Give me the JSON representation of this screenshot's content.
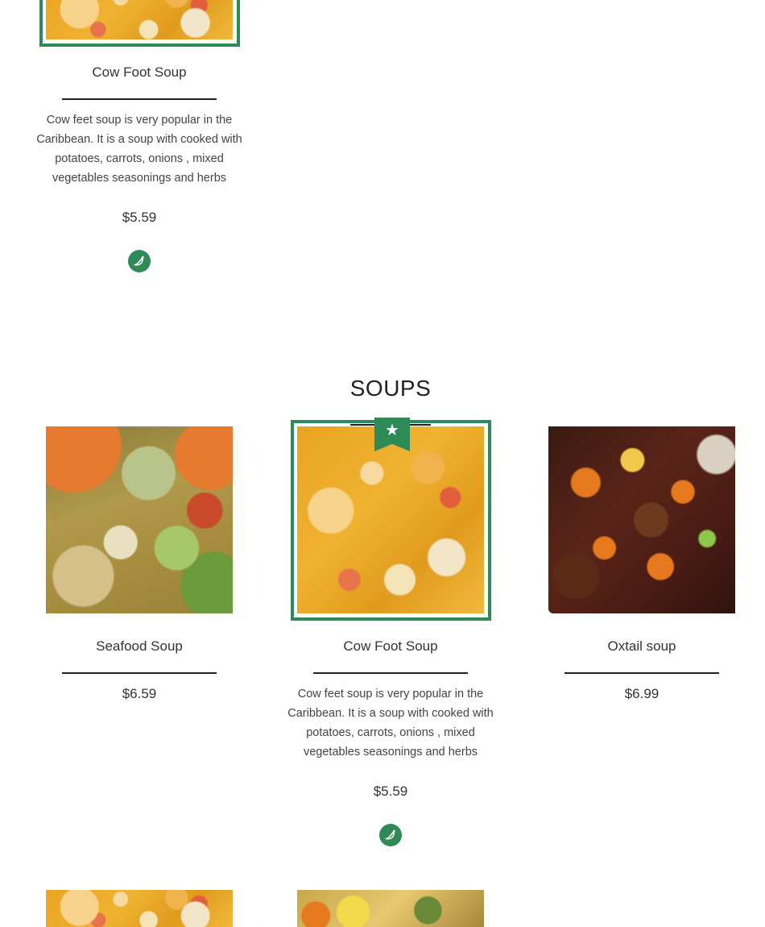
{
  "colors": {
    "accent": "#2e8b57",
    "text": "#333333",
    "rule": "#222222"
  },
  "top_item": {
    "name": "Cow Foot Soup",
    "description": "Cow feet soup is very popular in the Caribbean. It is a soup with cooked with potatoes, carrots, onions , mixed vegetables seasonings and herbs",
    "price": "$5.59",
    "spicy_icon": "chili-pepper-icon"
  },
  "section": {
    "heading": "SOUPS",
    "items": [
      {
        "name": "Seafood Soup",
        "price": "$6.59"
      },
      {
        "name": "Cow Foot Soup",
        "description": "Cow feet soup is very popular in the Caribbean. It is a soup with cooked with potatoes, carrots, onions , mixed vegetables seasonings and herbs",
        "price": "$5.59",
        "featured": true,
        "badge_icon": "star-icon",
        "spicy_icon": "chili-pepper-icon"
      },
      {
        "name": "Oxtail soup",
        "price": "$6.99"
      }
    ]
  }
}
